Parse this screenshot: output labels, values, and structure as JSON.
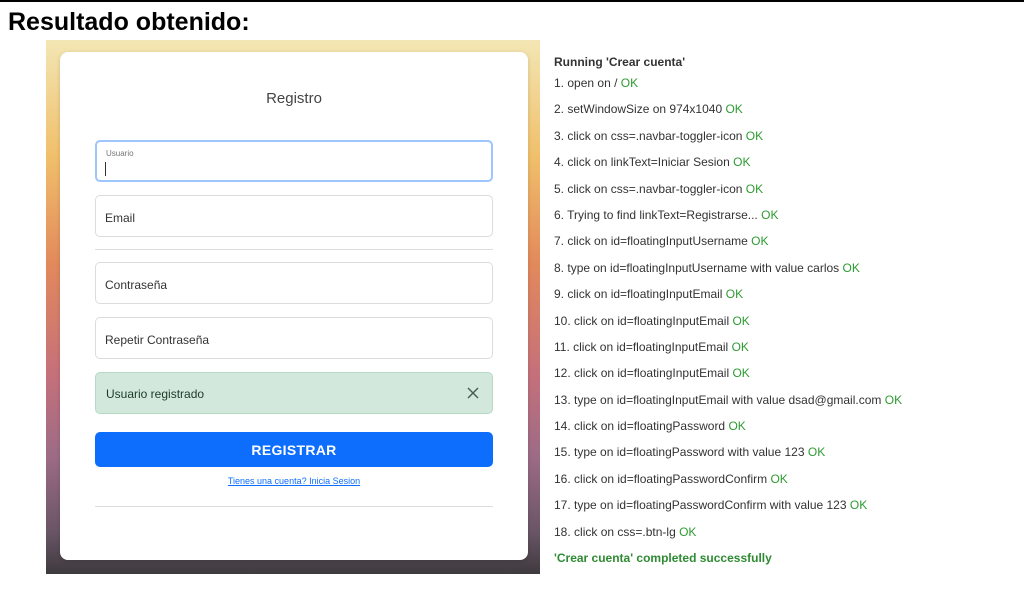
{
  "heading": "Resultado obtenido:",
  "form": {
    "title": "Registro",
    "fields": {
      "username_label": "Usuario",
      "email_label": "Email",
      "password_label": "Contraseña",
      "confirm_label": "Repetir Contraseña"
    },
    "alert_text": "Usuario registrado",
    "submit_label": "REGISTRAR",
    "login_link": "Tienes una cuenta? Inicia Sesion"
  },
  "log": {
    "title": "Running 'Crear cuenta'",
    "steps": [
      {
        "num": "1.",
        "text": "open on /",
        "status": "OK"
      },
      {
        "num": "2.",
        "text": "setWindowSize on 974x1040",
        "status": "OK"
      },
      {
        "num": "3.",
        "text": "click on css=.navbar-toggler-icon",
        "status": "OK"
      },
      {
        "num": "4.",
        "text": "click on linkText=Iniciar Sesion",
        "status": "OK"
      },
      {
        "num": "5.",
        "text": "click on css=.navbar-toggler-icon",
        "status": "OK"
      },
      {
        "num": "6.",
        "text": "Trying to find linkText=Registrarse...",
        "status": "OK"
      },
      {
        "num": "7.",
        "text": "click on id=floatingInputUsername",
        "status": "OK"
      },
      {
        "num": "8.",
        "text": "type on id=floatingInputUsername with value carlos",
        "status": "OK"
      },
      {
        "num": "9.",
        "text": "click on id=floatingInputEmail",
        "status": "OK"
      },
      {
        "num": "10.",
        "text": "click on id=floatingInputEmail",
        "status": "OK"
      },
      {
        "num": "11.",
        "text": "click on id=floatingInputEmail",
        "status": "OK"
      },
      {
        "num": "12.",
        "text": "click on id=floatingInputEmail",
        "status": "OK"
      },
      {
        "num": "13.",
        "text": "type on id=floatingInputEmail with value dsad@gmail.com",
        "status": "OK"
      },
      {
        "num": "14.",
        "text": "click on id=floatingPassword",
        "status": "OK"
      },
      {
        "num": "15.",
        "text": "type on id=floatingPassword with value 123",
        "status": "OK"
      },
      {
        "num": "16.",
        "text": "click on id=floatingPasswordConfirm",
        "status": "OK"
      },
      {
        "num": "17.",
        "text": "type on id=floatingPasswordConfirm with value 123",
        "status": "OK"
      },
      {
        "num": "18.",
        "text": "click on css=.btn-lg",
        "status": "OK"
      }
    ],
    "completed": "'Crear cuenta' completed successfully"
  },
  "colors": {
    "primary": "#0d6efd",
    "ok_green": "#2e9a32",
    "alert_bg": "#d3e8dc"
  },
  "icons": {
    "alert_close": "close-icon"
  }
}
